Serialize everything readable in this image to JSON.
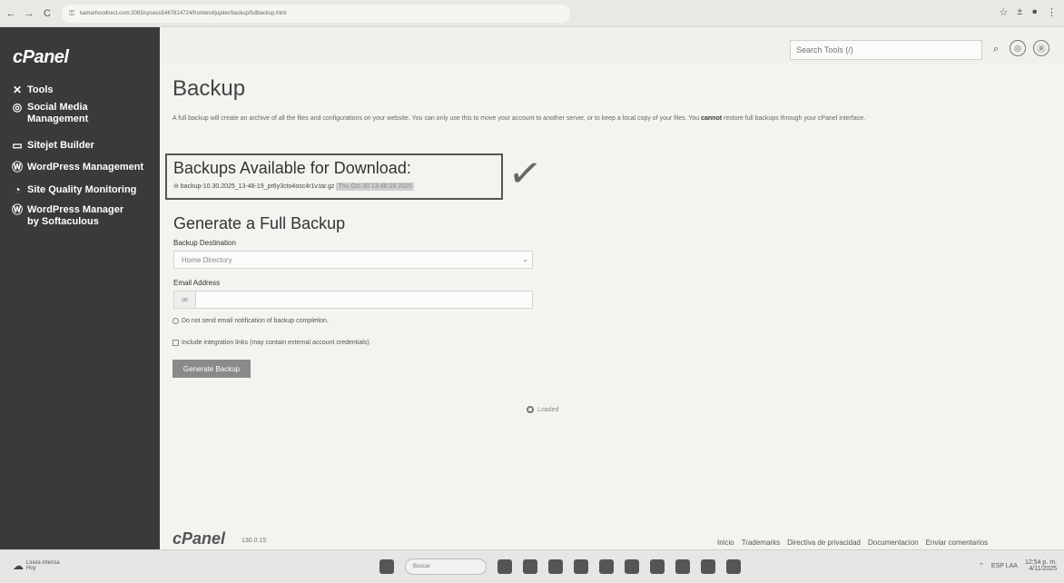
{
  "browser": {
    "url": "kamarhoodirect.com:2083/cpsess5467814724/frontend/jupiter/backup/fullbackup.html",
    "nav": [
      "←",
      "→",
      "C"
    ],
    "right_icons": [
      "☆",
      "±",
      "●",
      "⋮"
    ]
  },
  "sidebar": {
    "logo": "cPanel",
    "items": [
      {
        "icon": "✕",
        "label": "Tools"
      },
      {
        "icon": "◎",
        "label": "Social Media Management"
      },
      {
        "icon": "▭",
        "label": "Sitejet Builder"
      },
      {
        "icon": "Ⓦ",
        "label": "WordPress Management"
      },
      {
        "icon": "◔",
        "label": "Site Quality Monitoring"
      },
      {
        "icon": "Ⓦ",
        "label": "WordPress Manager by Softaculous"
      }
    ]
  },
  "header": {
    "search_placeholder": "Search Tools (/)",
    "search_icon": "⌕",
    "icons": [
      "◎",
      "Ⓡ"
    ]
  },
  "main": {
    "title": "Backup",
    "description_pre": "A full backup will create an archive of all the files and configurations on your website. You can only use this to move your account to another server, or to keep a local copy of your files. You ",
    "description_bold": "cannot",
    "description_post": " restore full backups through your cPanel interface.",
    "available": {
      "title": "Backups Available for Download:",
      "file_icon": "⊖",
      "file_name": "backup-10.30.2025_13-48-19_pr6y3cto4osc4r1v.tar.gz",
      "file_date": "Thu Oct 30 13:48:19 2025"
    },
    "check_mark": "✓",
    "generate": {
      "title": "Generate a Full Backup",
      "destination_label": "Backup Destination",
      "destination_value": "Home Directory",
      "email_label": "Email Address",
      "email_addon": "✉",
      "no_email_option": "Do not send email notification of backup completion.",
      "include_links_option": "Include integration links (may contain external account credentials).",
      "button": "Generate Backup"
    },
    "loading_text": "Loaded"
  },
  "footer": {
    "logo": "cPanel",
    "version": "130.0.15",
    "links": [
      "Inicio",
      "Trademarks",
      "Directiva de privacidad",
      "Documentacion",
      "Enviar comentarios"
    ]
  },
  "taskbar": {
    "weather_temp": "Lluvia intensa",
    "weather_sub": "Hoy",
    "search_placeholder": "Buscar",
    "lang": "ESP LAA",
    "time": "12:54 p. m.",
    "date": "4/11/2025"
  }
}
